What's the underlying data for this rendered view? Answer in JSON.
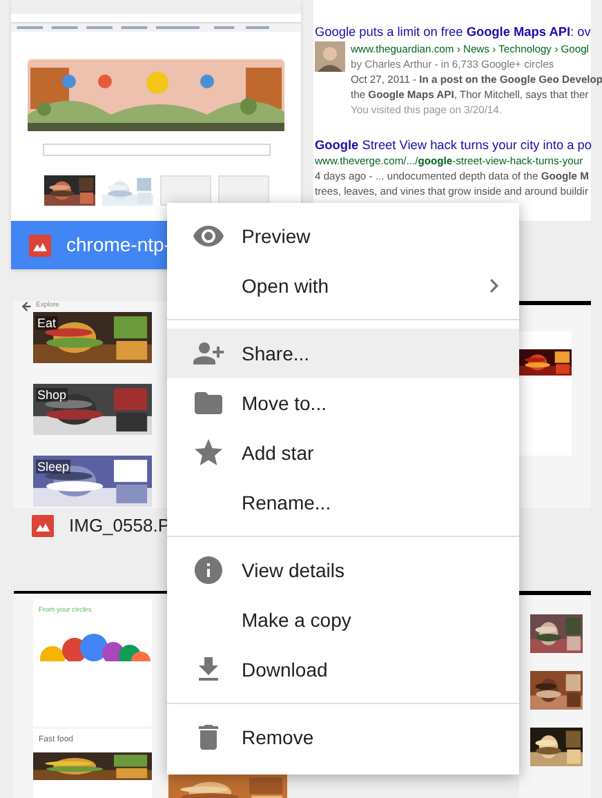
{
  "files": [
    {
      "kind": "browser",
      "name": "chrome-ntp-",
      "selected": true
    },
    {
      "kind": "search",
      "results": [
        {
          "title": "Google puts a limit on free **Google Maps API**: ov",
          "url": "www.theguardian.com › News › Technology › Googl",
          "byline": "by Charles Arthur - in 6,733 Google+ circles",
          "snippet": [
            "Oct 27, 2011 - **In a post on the Google Geo Develop**",
            "the **Google Maps API**, Thor Mitchell, says that ther"
          ],
          "visited": "You visited this page on 3/20/14."
        },
        {
          "title": "**Google** Street View hack turns your city into a po",
          "url": "www.theverge.com/.../**google**-street-view-hack-turns-your",
          "snippet": [
            "4 days ago - ... undocumented depth data of the **Google M**",
            "trees, leaves, and vines that grow inside and around buildir"
          ]
        }
      ]
    },
    {
      "kind": "explore",
      "name": "IMG_0558.P",
      "selected": false,
      "back": "Explore",
      "tiles": [
        "Eat",
        "Shop",
        "Sleep"
      ]
    },
    {
      "kind": "photos"
    },
    {
      "kind": "circles",
      "title": "From your circles",
      "section": "Fast food"
    },
    {
      "kind": "reviews"
    }
  ],
  "menu": {
    "groups": [
      [
        {
          "label": "Preview",
          "submenu": false,
          "selected": false
        },
        {
          "label": "Open with",
          "submenu": true,
          "selected": false
        }
      ],
      [
        {
          "label": "Share...",
          "submenu": false,
          "selected": true
        },
        {
          "label": "Move to...",
          "submenu": false,
          "selected": false
        },
        {
          "label": "Add star",
          "submenu": false,
          "selected": false
        },
        {
          "label": "Rename...",
          "submenu": false,
          "selected": false
        }
      ],
      [
        {
          "label": "View details",
          "submenu": false,
          "selected": false
        },
        {
          "label": "Make a copy",
          "submenu": false,
          "selected": false
        },
        {
          "label": "Download",
          "submenu": false,
          "selected": false
        }
      ],
      [
        {
          "label": "Remove",
          "submenu": false,
          "selected": false
        }
      ]
    ]
  }
}
